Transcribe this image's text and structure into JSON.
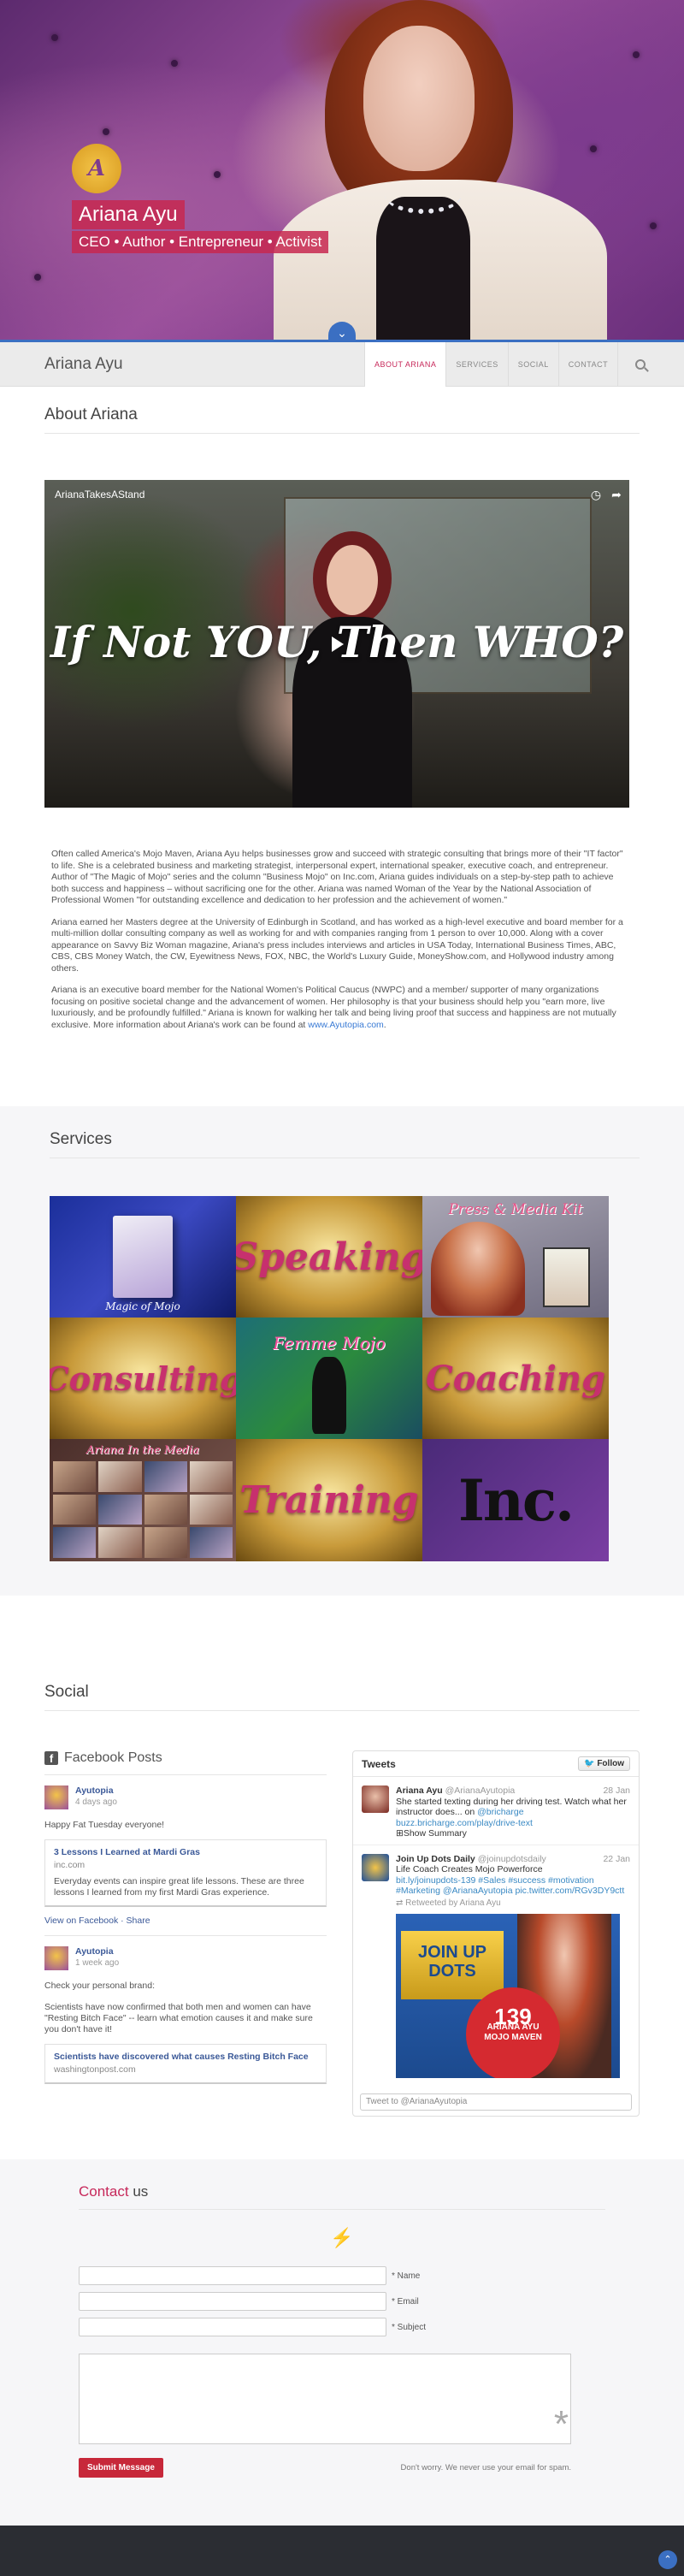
{
  "hero": {
    "name": "Ariana Ayu",
    "tagline": "CEO • Author • Entrepreneur • Activist",
    "logo_letter": "A",
    "scroll_icon": "chevron-down-icon"
  },
  "navbar": {
    "brand": "Ariana Ayu",
    "items": [
      {
        "label": "ABOUT ARIANA",
        "active": true
      },
      {
        "label": "SERVICES",
        "active": false
      },
      {
        "label": "SOCIAL",
        "active": false
      },
      {
        "label": "CONTACT",
        "active": false
      }
    ],
    "search_icon": "search-icon"
  },
  "about": {
    "title": "About Ariana",
    "video": {
      "channel": "ArianaTakesAStand",
      "overlay_text": "If Not YOU, Then WHO?"
    },
    "paragraphs": [
      "Often called America's Mojo Maven, Ariana Ayu helps businesses grow and succeed with strategic consulting that brings more of their \"IT factor\" to life. She is a celebrated business and marketing strategist, interpersonal expert, international speaker, executive coach, and entrepreneur. Author of \"The Magic of Mojo\" series and the column \"Business Mojo\" on Inc.com, Ariana guides individuals on a step-by-step path to achieve both success and happiness – without sacrificing one for the other. Ariana was named Woman of the Year by the National Association of Professional Women \"for outstanding excellence and dedication to her profession and the achievement of women.\"",
      "Ariana earned her Masters degree at the University of Edinburgh in Scotland, and has worked as a high-level executive and board member for a multi-million dollar consulting company as well as working for and with companies ranging from 1 person to over 10,000. Along with a cover appearance on Savvy Biz Woman magazine, Ariana's press includes interviews and articles in USA Today, International Business Times, ABC, CBS, CBS Money Watch, the CW, Eyewitness News, FOX, NBC, the World's Luxury Guide, MoneyShow.com, and Hollywood industry among others.",
      "Ariana is an executive board member for the National Women's Political Caucus (NWPC) and a member/ supporter of many organizations focusing on positive societal change and the advancement of women. Her philosophy is that your business should help you \"earn more, live luxuriously, and be profoundly fulfilled.\" Ariana is known for walking her talk and being living proof that success and happiness are not mutually exclusive. More information about Ariana's work can be found at"
    ],
    "link": "www.Ayutopia.com",
    "link_suffix": "."
  },
  "services": {
    "title": "Services",
    "tiles": {
      "book_label": "Magic of Mojo",
      "speaking": "Speaking",
      "press": "Press & Media Kit",
      "consulting": "Consulting",
      "femme": "Femme Mojo",
      "coaching": "Coaching",
      "media": "Ariana In the Media",
      "training": "Training",
      "inc": "Inc."
    }
  },
  "social": {
    "title": "Social",
    "facebook": {
      "header": "Facebook Posts",
      "posts": [
        {
          "author": "Ayutopia",
          "time": "4 days ago",
          "text": "Happy Fat Tuesday everyone!",
          "attach_title": "3 Lessons I Learned at Mardi Gras",
          "attach_domain": "inc.com",
          "attach_text": "Everyday events can inspire great life lessons. These are three lessons I learned from my first Mardi Gras experience.",
          "links": "View on Facebook · Share"
        },
        {
          "author": "Ayutopia",
          "time": "1 week ago",
          "text": "Check your personal brand:",
          "text2": "Scientists have now confirmed that both men and women can have \"Resting Bitch Face\" -- learn what emotion causes it and make sure you don't have it!",
          "attach_title": "Scientists have discovered what causes Resting Bitch Face",
          "attach_domain": "washingtonpost.com"
        }
      ]
    },
    "twitter": {
      "title": "Tweets",
      "follow": "Follow",
      "tweets": [
        {
          "name": "Ariana Ayu",
          "handle": "@ArianaAyutopia",
          "date": "28 Jan",
          "text": "She started texting during her driving test. Watch what her instructor does... on",
          "mention": "@bricharge",
          "url": "buzz.bricharge.com/play/drive-text",
          "extra": "Show Summary"
        },
        {
          "name": "Join Up Dots Daily",
          "handle": "@joinupdotsdaily",
          "date": "22 Jan",
          "text": "Life Coach Creates Mojo Powerforce",
          "links": "bit.ly/joinupdots-139 #Sales #success #motivation #Marketing @ArianaAyutopia pic.twitter.com/RGv3DY9ctt",
          "retweet": "Retweeted by Ariana Ayu",
          "media_text": "JOIN UP DOTS",
          "badge_number": "139",
          "badge_line1": "ARIANA AYU",
          "badge_line2": "MOJO MAVEN"
        }
      ],
      "input_placeholder": "Tweet to @ArianaAyutopia"
    }
  },
  "contact": {
    "title_highlight": "Contact",
    "title_rest": " us",
    "fields": [
      {
        "label": "* Name"
      },
      {
        "label": "* Email"
      },
      {
        "label": "* Subject"
      }
    ],
    "submit": "Submit Message",
    "spam_note": "Don't worry. We never use your email for spam."
  },
  "colors": {
    "accent": "#c7285a",
    "blue": "#3b6fc2",
    "footer": "#2b2d33"
  }
}
